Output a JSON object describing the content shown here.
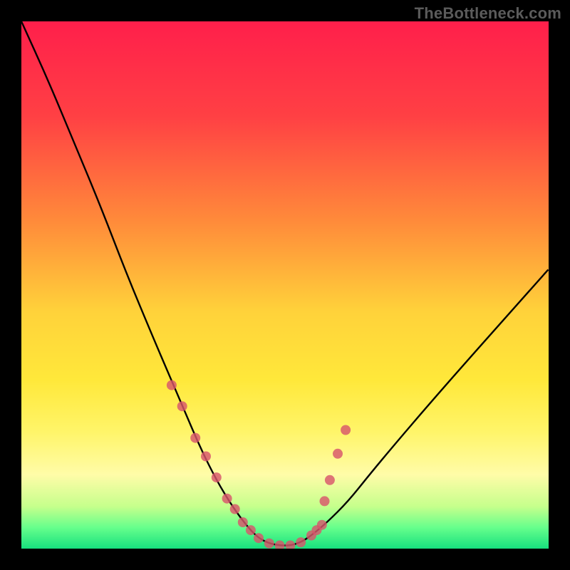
{
  "watermark": "TheBottleneck.com",
  "chart_data": {
    "type": "line",
    "title": "",
    "xlabel": "",
    "ylabel": "",
    "xlim": [
      0,
      100
    ],
    "ylim": [
      0,
      100
    ],
    "gradient_stops": [
      {
        "offset": 0,
        "color": "#ff1f4b"
      },
      {
        "offset": 18,
        "color": "#ff4044"
      },
      {
        "offset": 38,
        "color": "#ff8b3a"
      },
      {
        "offset": 55,
        "color": "#ffd23a"
      },
      {
        "offset": 68,
        "color": "#ffe83a"
      },
      {
        "offset": 78,
        "color": "#fff56a"
      },
      {
        "offset": 86,
        "color": "#fffca8"
      },
      {
        "offset": 92,
        "color": "#c6ff8c"
      },
      {
        "offset": 96,
        "color": "#66ff8c"
      },
      {
        "offset": 100,
        "color": "#17e07e"
      }
    ],
    "series": [
      {
        "name": "bottleneck-curve",
        "color": "#000000",
        "x": [
          0,
          5,
          10,
          15,
          20,
          25,
          28,
          31,
          34,
          37,
          40,
          43,
          45,
          47,
          49,
          51,
          53,
          55,
          58,
          62,
          66,
          71,
          77,
          84,
          92,
          100
        ],
        "values": [
          100,
          89,
          77,
          65,
          52,
          40,
          33,
          26,
          19,
          13,
          8,
          4,
          2,
          1,
          0.6,
          0.6,
          1.2,
          2.5,
          5,
          9,
          14,
          20,
          27,
          35,
          44,
          53
        ]
      }
    ],
    "markers": {
      "color": "#d8566b",
      "radius": 7,
      "x": [
        28.5,
        30.5,
        33.0,
        35.0,
        37.0,
        39.0,
        40.5,
        42.0,
        43.5,
        45.0,
        47.0,
        49.0,
        51.0,
        53.0,
        55.0,
        56.0,
        57.0,
        57.5,
        58.5,
        60.0,
        61.5
      ],
      "values": [
        31,
        27,
        21,
        17.5,
        13.5,
        9.5,
        7.5,
        5.0,
        3.5,
        2.0,
        1.0,
        0.6,
        0.6,
        1.2,
        2.5,
        3.5,
        4.5,
        9.0,
        13.0,
        18.0,
        22.5
      ]
    }
  }
}
